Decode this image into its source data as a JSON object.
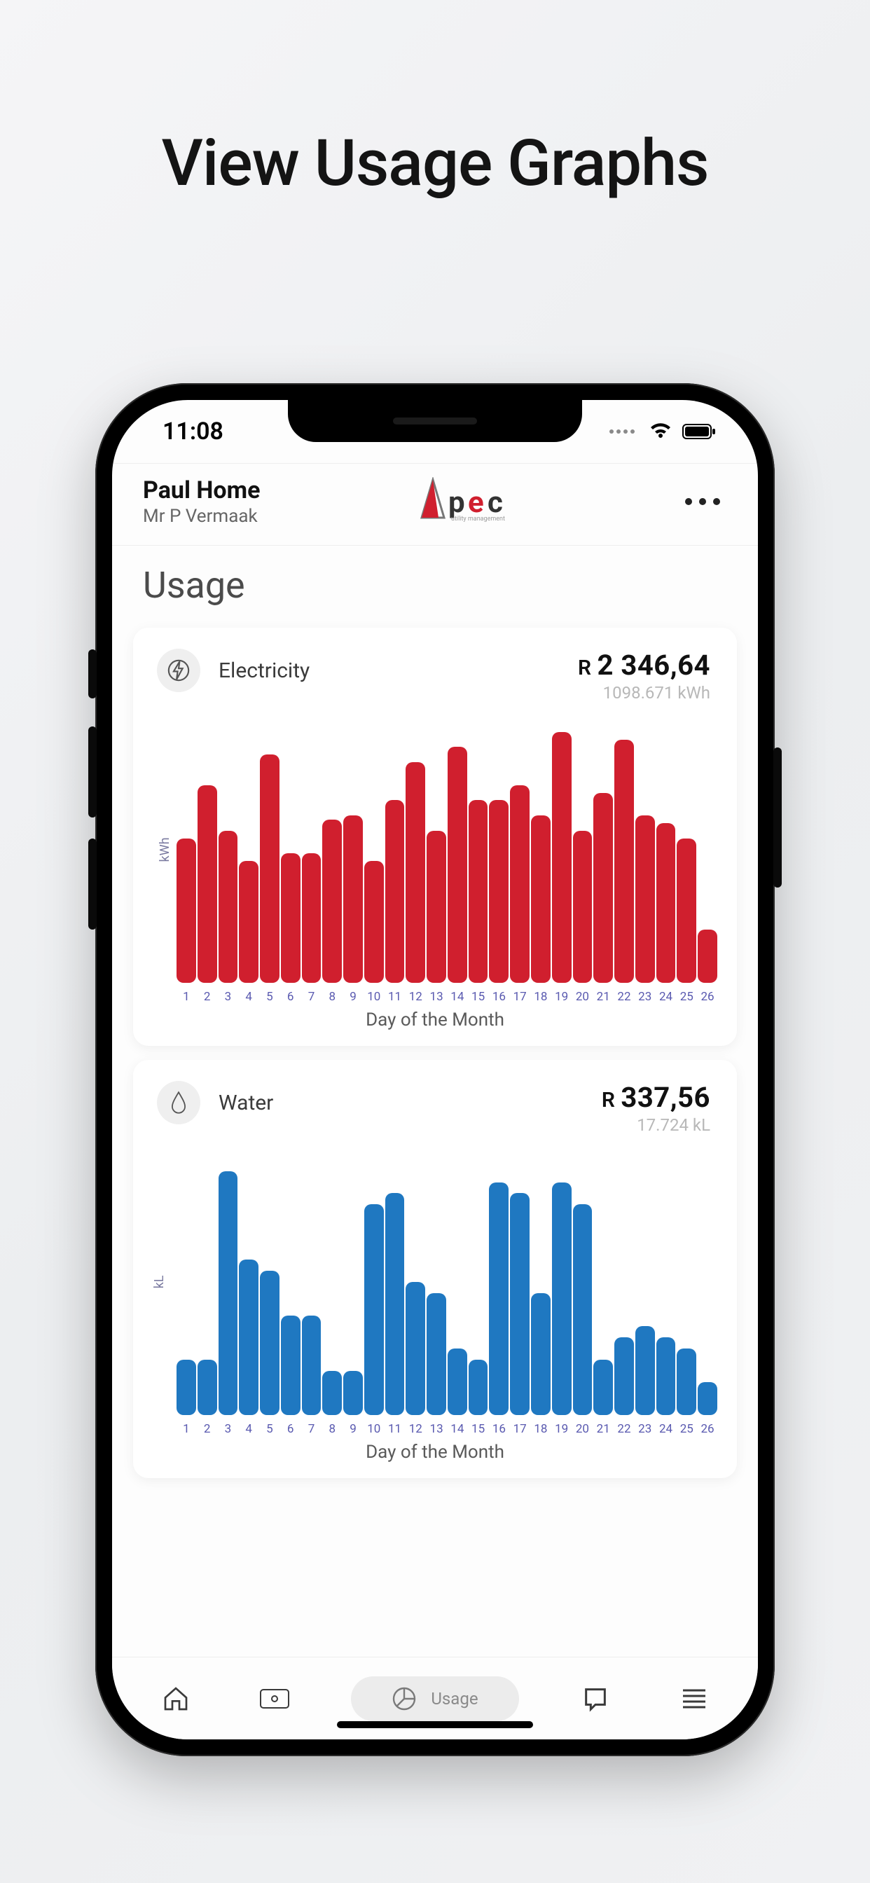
{
  "promo_title": "View Usage Graphs",
  "status": {
    "time": "11:08"
  },
  "header": {
    "account_name": "Paul Home",
    "account_holder": "Mr P Vermaak",
    "logo_text": "pec",
    "logo_sub": "utility management"
  },
  "page_title": "Usage",
  "cards": {
    "electricity": {
      "title": "Electricity",
      "amount_currency": "R",
      "amount": "2 346,64",
      "sub": "1098.671 kWh",
      "ylabel": "kWh",
      "xlabel": "Day of the Month"
    },
    "water": {
      "title": "Water",
      "amount_currency": "R",
      "amount": "337,56",
      "sub": "17.724 kL",
      "ylabel": "kL",
      "xlabel": "Day of the Month"
    }
  },
  "tabbar": {
    "active_label": "Usage"
  },
  "chart_data": [
    {
      "type": "bar",
      "series_name": "Electricity",
      "color": "#d01f2e",
      "xlabel": "Day of the Month",
      "ylabel": "kWh",
      "ylim": [
        0,
        70
      ],
      "categories": [
        1,
        2,
        3,
        4,
        5,
        6,
        7,
        8,
        9,
        10,
        11,
        12,
        13,
        14,
        15,
        16,
        17,
        18,
        19,
        20,
        21,
        22,
        23,
        24,
        25,
        26
      ],
      "values": [
        38,
        52,
        40,
        32,
        60,
        34,
        34,
        43,
        44,
        32,
        48,
        58,
        40,
        62,
        48,
        48,
        52,
        44,
        66,
        40,
        50,
        64,
        44,
        42,
        38,
        14
      ]
    },
    {
      "type": "bar",
      "series_name": "Water",
      "color": "#1f78c1",
      "xlabel": "Day of the Month",
      "ylabel": "kL",
      "ylim": [
        0,
        1.2
      ],
      "categories": [
        1,
        2,
        3,
        4,
        5,
        6,
        7,
        8,
        9,
        10,
        11,
        12,
        13,
        14,
        15,
        16,
        17,
        18,
        19,
        20,
        21,
        22,
        23,
        24,
        25,
        26
      ],
      "values": [
        0.25,
        0.25,
        1.1,
        0.7,
        0.65,
        0.45,
        0.45,
        0.2,
        0.2,
        0.95,
        1.0,
        0.6,
        0.55,
        0.3,
        0.25,
        1.05,
        1.0,
        0.55,
        1.05,
        0.95,
        0.25,
        0.35,
        0.4,
        0.35,
        0.3,
        0.15
      ]
    }
  ]
}
